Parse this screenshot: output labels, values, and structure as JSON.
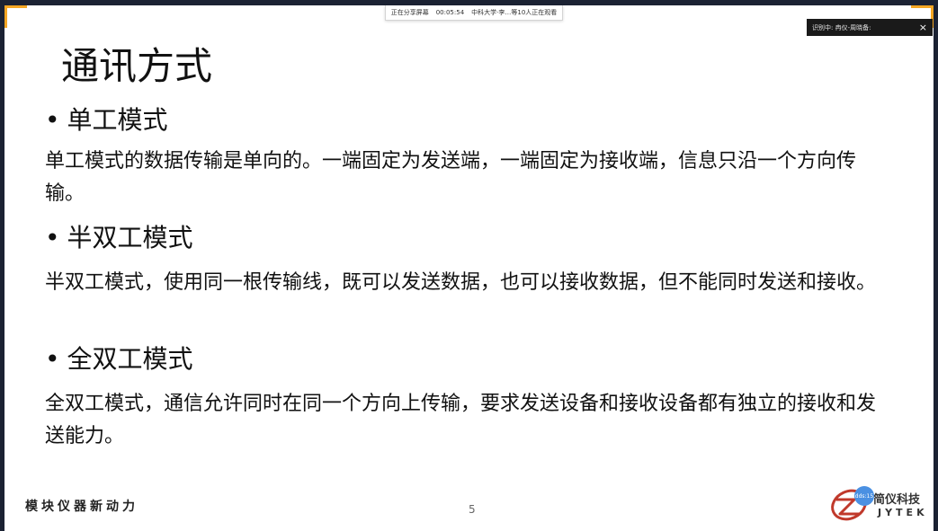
{
  "share_bar": {
    "status": "正在分享屏幕",
    "timer": "00:05:54",
    "participants": "中科大学·李…等10人正在观看"
  },
  "caption_bar": {
    "text": "识别中: 冉仪-周晓备:",
    "close": "×"
  },
  "slide": {
    "title": "通讯方式",
    "sections": [
      {
        "bullet": "单工模式",
        "text": "单工模式的数据传输是单向的。一端固定为发送端，一端固定为接收端，信息只沿一个方向传输。"
      },
      {
        "bullet": "半双工模式",
        "text": "半双工模式，使用同一根传输线，既可以发送数据，也可以接收数据，但不能同时发送和接收。"
      },
      {
        "bullet": "全双工模式",
        "text": "全双工模式，通信允许同时在同一个方向上传输，要求发送设备和接收设备都有独立的接收和发送能力。"
      }
    ],
    "bullet_mark": "•",
    "footer_slogan": "模块仪器新动力",
    "page_number": "5"
  },
  "logo": {
    "cn": "简仪科技",
    "en": "JYTEK",
    "color": "#c0392b"
  },
  "avatar_label": "dds:15"
}
